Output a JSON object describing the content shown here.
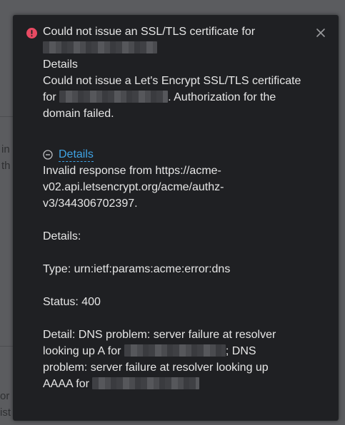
{
  "background": {
    "fragments": [
      "in",
      "th",
      "or",
      "ist"
    ]
  },
  "notification": {
    "status_icon": "error-circle-icon",
    "close_icon": "close-x-icon",
    "title_line1": "Could not issue an SSL/TLS certificate for",
    "details_heading": "Details",
    "message_line1": "Could not issue a Let's Encrypt SSL/TLS certificate",
    "message_line2_prefix": "for",
    "message_line2_suffix": ". Authorization for the",
    "message_line3": "domain failed.",
    "toggle_icon": "minus-circle-icon",
    "toggle_label": "Details",
    "detail_lines": {
      "response_1": "Invalid response from https://acme-",
      "response_2": "v02.api.letsencrypt.org/acme/authz-",
      "response_3": "v3/344306702397.",
      "details_label": "Details:",
      "type": "Type: urn:ietf:params:acme:error:dns",
      "status": "Status: 400",
      "detail_1": "Detail: DNS problem: server failure at resolver",
      "detail_2_prefix": "looking up A for",
      "detail_2_suffix": "; DNS",
      "detail_3": "problem: server failure at resolver looking up",
      "detail_4_prefix": "AAAA for"
    }
  }
}
